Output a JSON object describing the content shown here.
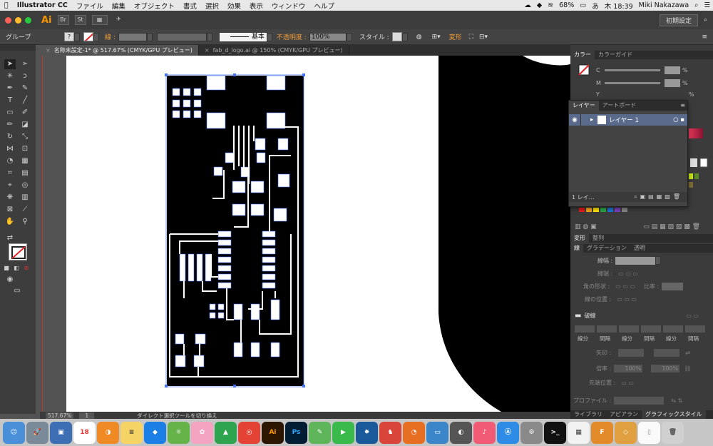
{
  "menubar": {
    "apple": "",
    "app_name": "Illustrator CC",
    "items": [
      "ファイル",
      "編集",
      "オブジェクト",
      "書式",
      "選択",
      "効果",
      "表示",
      "ウィンドウ",
      "ヘルプ"
    ],
    "battery": "68%",
    "input_lang": "あ",
    "clock": "木 18:39",
    "user": "Miki Nakazawa"
  },
  "appbar": {
    "logo": "Ai",
    "workspace_label": "初期設定"
  },
  "controlbar": {
    "selection_type": "グループ",
    "stroke_label": "線 :",
    "stroke_style": "基本",
    "opacity_label": "不透明度 :",
    "opacity_value": "100%",
    "style_label": "スタイル :",
    "transform_label": "変形"
  },
  "tabs": [
    {
      "label": "名称未設定-1* @ 517.67% (CMYK/GPU プレビュー)",
      "active": true
    },
    {
      "label": "fab_d_logo.ai @ 150% (CMYK/GPU プレビュー)",
      "active": false
    }
  ],
  "status": {
    "zoom": "517.67%",
    "page": "1",
    "tool_hint": "ダイレクト選択ツールを切り換え"
  },
  "color_panel": {
    "tabs": [
      "カラー",
      "カラーガイド"
    ],
    "rows": [
      {
        "label": "C",
        "unit": "%"
      },
      {
        "label": "M",
        "unit": "%"
      },
      {
        "label": "Y",
        "unit": "%"
      }
    ]
  },
  "layers_panel": {
    "tabs": [
      "レイヤー",
      "アートボード"
    ],
    "layer_name": "レイヤー 1",
    "footer": "1 レイ…"
  },
  "transform_tabs": [
    "変形",
    "整列"
  ],
  "stroke_panel": {
    "tabs": [
      "線",
      "グラデーション",
      "透明"
    ],
    "weight_label": "線幅 :",
    "cap_label": "線端 :",
    "corner_label": "角の形状 :",
    "limit_label": "比率 :",
    "align_label": "線の位置 :",
    "dashed_label": "破線",
    "dash_labels": [
      "線分",
      "間隔",
      "線分",
      "間隔",
      "線分",
      "間隔"
    ],
    "arrow_label": "矢印 :",
    "scale_label": "倍率 :",
    "scale_values": [
      "100%",
      "100%"
    ],
    "align_arrow_label": "先端位置 :",
    "profile_label": "プロファイル :"
  },
  "bottom_tabs": [
    "ライブラリ",
    "アピアラン",
    "グラフィックスタイル"
  ],
  "dock_apps": [
    "Finder",
    "Launchpad",
    "Mail",
    "Calendar",
    "Blender",
    "Notes",
    "Dropbox",
    "Atom",
    "Photos",
    "Drive",
    "Chrome",
    "Ai",
    "Ps",
    "Evernote",
    "FaceTime",
    "Sourcetree",
    "Pecker",
    "Kindle",
    "Keynote",
    "Spark",
    "Music",
    "App Store",
    "System Prefs",
    "Terminal",
    "Grid",
    "Fusion",
    "Sketch",
    "Doc",
    "Trash"
  ]
}
